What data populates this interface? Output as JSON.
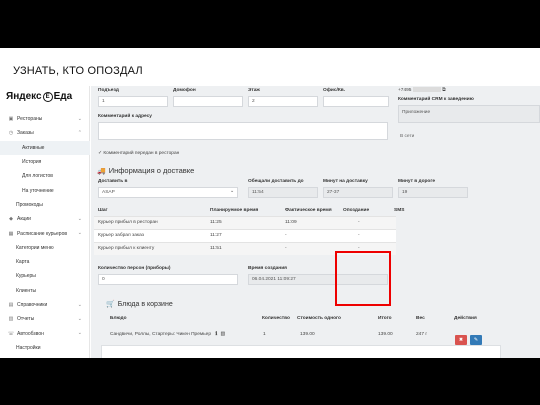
{
  "slide": {
    "title": "УЗНАТЬ, КТО ОПОЗДАЛ"
  },
  "logo": {
    "brand": "Яндекс",
    "letter": "Е",
    "product": "Еда"
  },
  "sidebar": {
    "items": [
      {
        "label": "Рестораны",
        "icon": "store-icon"
      },
      {
        "label": "Заказы",
        "icon": "clock-icon"
      },
      {
        "label": "Активные"
      },
      {
        "label": "История"
      },
      {
        "label": "Для логистов"
      },
      {
        "label": "На уточнение"
      },
      {
        "label": "Промокоды"
      },
      {
        "label": "Акции",
        "icon": "tag-icon"
      },
      {
        "label": "Расписание курьеров",
        "icon": "calendar-icon"
      },
      {
        "label": "Категории меню"
      },
      {
        "label": "Карта"
      },
      {
        "label": "Курьеры"
      },
      {
        "label": "Клиенты"
      },
      {
        "label": "Справочники",
        "icon": "book-icon"
      },
      {
        "label": "Отчеты",
        "icon": "report-icon"
      },
      {
        "label": "Автообзвон",
        "icon": "phone-icon"
      },
      {
        "label": "Настройки"
      }
    ]
  },
  "address": {
    "entrance_label": "Подъезд",
    "entrance_value": "1",
    "intercom_label": "Домофон",
    "intercom_value": "",
    "floor_label": "Этаж",
    "floor_value": "2",
    "office_label": "Офис/Кв.",
    "office_value": "",
    "comment_label": "Комментарий к адресу",
    "comment_passed": "Комментарий передан в ресторан",
    "phone": "+7495",
    "crm_label": "Комментарий CRM к заведению",
    "crm_value": "Приложение",
    "network": "В сети"
  },
  "delivery": {
    "heading": "Информация о доставке",
    "delivery_to_label": "Доставить в",
    "delivery_to_value": "ASAP",
    "promised_label": "Обещали доставить до",
    "promised_value": "11:54",
    "minutes_label": "Минут на доставку",
    "minutes_value": "27-37",
    "road_label": "Минут в дороге",
    "road_value": "19"
  },
  "steps": {
    "columns": [
      "Шаг",
      "Планируемое время",
      "Фактическое время",
      "Опоздание",
      "SMS"
    ],
    "rows": [
      {
        "step": "Курьер прибыл в ресторан",
        "planned": "11:25",
        "actual": "11:09",
        "late": "-",
        "sms": ""
      },
      {
        "step": "Курьер забрал заказ",
        "planned": "11:27",
        "actual": "-",
        "late": "-",
        "sms": ""
      },
      {
        "step": "Курьер прибыл к клиенту",
        "planned": "11:51",
        "actual": "-",
        "late": "-",
        "sms": ""
      }
    ]
  },
  "persons": {
    "label": "Количество персон (приборы)",
    "value": "0",
    "created_label": "Время создания",
    "created_value": "06.04.2021 11:09:27"
  },
  "cart": {
    "heading": "Блюда в корзине",
    "columns": [
      "Блюдо",
      "Количество",
      "Стоимость одного",
      "Итого",
      "Вес",
      "Действия"
    ],
    "rows": [
      {
        "dish": "Сандвичи, Роллы, Стартеры: Чикен Премьер",
        "qty": "1",
        "price": "139.00",
        "total": "139.00",
        "weight": "247 г"
      }
    ]
  },
  "colors": {
    "highlight": "#ee0000",
    "danger": "#d9534f",
    "primary": "#337ab7"
  }
}
